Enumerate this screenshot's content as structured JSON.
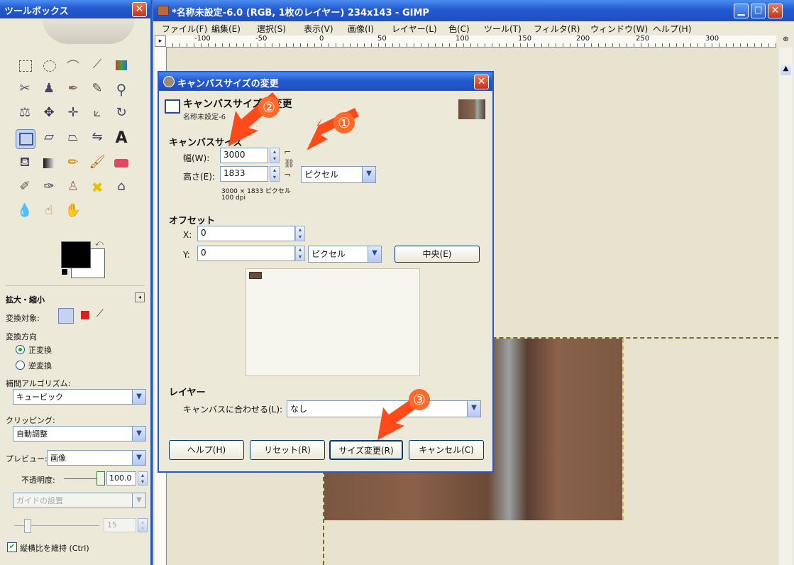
{
  "toolbox": {
    "title": "ツールボックス",
    "zoom_title": "拡大・縮小",
    "transform_target_label": "変換対象:",
    "direction_label": "変換方向",
    "direction_options": [
      "正変換",
      "逆変換"
    ],
    "interp_label": "補間アルゴリズム:",
    "interp_value": "キュービック",
    "clipping_label": "クリッピング:",
    "clipping_value": "自動調整",
    "preview_label": "プレビュー:",
    "preview_value": "画像",
    "opacity_label": "不透明度:",
    "opacity_value": "100.0",
    "guide_value": "ガイドの設置",
    "grid_value": "15",
    "keep_ratio_label": "縦横比を維持 (Ctrl)"
  },
  "main": {
    "title": "*名称未設定-6.0 (RGB, 1枚のレイヤー) 234x143 - GIMP",
    "menus": [
      "ファイル(F)",
      "編集(E)",
      "選択(S)",
      "表示(V)",
      "画像(I)",
      "レイヤー(L)",
      "色(C)",
      "ツール(T)",
      "フィルタ(R)",
      "ウィンドウ(W)",
      "ヘルプ(H)"
    ],
    "ruler_ticks": [
      "-100",
      "-50",
      "0",
      "50",
      "100",
      "150",
      "200",
      "250",
      "300"
    ]
  },
  "dialog": {
    "title": "キャンバスサイズの変更",
    "header_title": "キャンバスサイズの変更",
    "header_sub": "名称未設定-6",
    "canvas_size_label": "キャンバスサイズ",
    "width_label": "幅(W):",
    "width_value": "3000",
    "height_label": "高さ(E):",
    "height_value": "1833",
    "unit_value": "ピクセル",
    "size_info": "3000 × 1833 ピクセル",
    "dpi_info": "100 dpi",
    "offset_label": "オフセット",
    "x_label": "X:",
    "x_value": "0",
    "y_label": "Y:",
    "y_value": "0",
    "offset_unit": "ピクセル",
    "center_button": "中央(E)",
    "layer_label": "レイヤー",
    "fit_label": "キャンバスに合わせる(L):",
    "fit_value": "なし",
    "help_button": "ヘルプ(H)",
    "reset_button": "リセット(R)",
    "resize_button": "サイズ変更(R)",
    "cancel_button": "キャンセル(C)"
  },
  "annotations": [
    "①",
    "②",
    "③"
  ],
  "colors": {
    "xp_blue": "#2459d0",
    "arrow": "#ff4a1a",
    "canvas_bg": "#ece9d8"
  }
}
